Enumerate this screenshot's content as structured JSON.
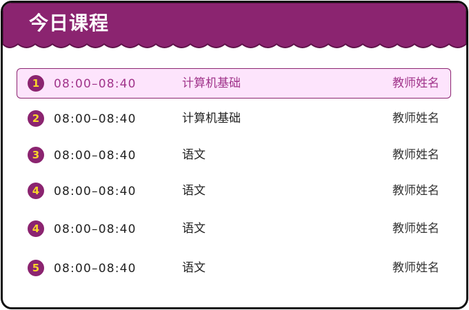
{
  "header": {
    "title": "今日课程"
  },
  "colors": {
    "header_bg": "#8b2470",
    "active_row_bg": "#fde4fc",
    "badge_bg": "#8b2470",
    "badge_text": "#f7d42b"
  },
  "schedule": [
    {
      "index": "1",
      "time": "08:00–08:40",
      "course": "计算机基础",
      "teacher": "教师姓名",
      "active": true
    },
    {
      "index": "2",
      "time": "08:00–08:40",
      "course": "计算机基础",
      "teacher": "教师姓名",
      "active": false
    },
    {
      "index": "3",
      "time": "08:00–08:40",
      "course": "语文",
      "teacher": "教师姓名",
      "active": false
    },
    {
      "index": "4",
      "time": "08:00–08:40",
      "course": "语文",
      "teacher": "教师姓名",
      "active": false
    },
    {
      "index": "4",
      "time": "08:00–08:40",
      "course": "语文",
      "teacher": "教师姓名",
      "active": false
    },
    {
      "index": "5",
      "time": "08:00–08:40",
      "course": "语文",
      "teacher": "教师姓名",
      "active": false
    }
  ]
}
